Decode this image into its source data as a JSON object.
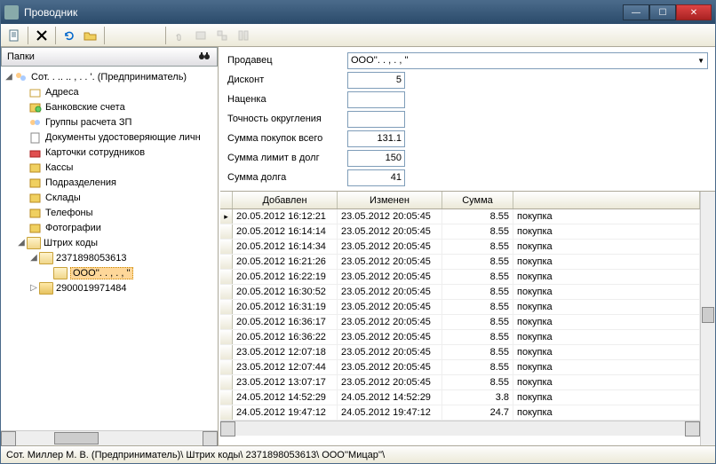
{
  "window": {
    "title": "Проводник"
  },
  "leftPanel": {
    "header": "Папки",
    "root": "Сот. .  .. .. ,  . .  '. (Предприниматель)",
    "items": [
      "Адреса",
      "Банковские счета",
      "Группы расчета ЗП",
      "Документы удостоверяющие личн",
      "Карточки сотрудников",
      "Кассы",
      "Подразделения",
      "Склады",
      "Телефоны",
      "Фотографии"
    ],
    "barcodeFolder": "Штрих коды",
    "barcode1": "2371898053613",
    "selected": "ООО''. .  , .  , ''",
    "barcode2": "2900019971484"
  },
  "form": {
    "labels": {
      "seller": "Продавец",
      "discount": "Дисконт",
      "markup": "Наценка",
      "rounding": "Точность округления",
      "totalBuys": "Сумма покупок всего",
      "creditLimit": "Сумма лимит в долг",
      "debt": "Сумма долга"
    },
    "values": {
      "seller": "ООО''. .  , .  , ''",
      "discount": "5",
      "markup": "",
      "rounding": "",
      "totalBuys": "131.1",
      "creditLimit": "150",
      "debt": "41"
    }
  },
  "grid": {
    "headers": {
      "added": "Добавлен",
      "changed": "Изменен",
      "sum": "Сумма"
    },
    "typeLabel": "покупка",
    "rows": [
      {
        "a": "20.05.2012 16:12:21",
        "c": "23.05.2012 20:05:45",
        "s": "8.55"
      },
      {
        "a": "20.05.2012 16:14:14",
        "c": "23.05.2012 20:05:45",
        "s": "8.55"
      },
      {
        "a": "20.05.2012 16:14:34",
        "c": "23.05.2012 20:05:45",
        "s": "8.55"
      },
      {
        "a": "20.05.2012 16:21:26",
        "c": "23.05.2012 20:05:45",
        "s": "8.55"
      },
      {
        "a": "20.05.2012 16:22:19",
        "c": "23.05.2012 20:05:45",
        "s": "8.55"
      },
      {
        "a": "20.05.2012 16:30:52",
        "c": "23.05.2012 20:05:45",
        "s": "8.55"
      },
      {
        "a": "20.05.2012 16:31:19",
        "c": "23.05.2012 20:05:45",
        "s": "8.55"
      },
      {
        "a": "20.05.2012 16:36:17",
        "c": "23.05.2012 20:05:45",
        "s": "8.55"
      },
      {
        "a": "20.05.2012 16:36:22",
        "c": "23.05.2012 20:05:45",
        "s": "8.55"
      },
      {
        "a": "23.05.2012 12:07:18",
        "c": "23.05.2012 20:05:45",
        "s": "8.55"
      },
      {
        "a": "23.05.2012 12:07:44",
        "c": "23.05.2012 20:05:45",
        "s": "8.55"
      },
      {
        "a": "23.05.2012 13:07:17",
        "c": "23.05.2012 20:05:45",
        "s": "8.55"
      },
      {
        "a": "24.05.2012 14:52:29",
        "c": "24.05.2012 14:52:29",
        "s": "3.8"
      },
      {
        "a": "24.05.2012 19:47:12",
        "c": "24.05.2012 19:47:12",
        "s": "24.7"
      }
    ]
  },
  "status": "Сот. Миллер М. В. (Предприниматель)\\ Штрих коды\\ 2371898053613\\ ООО''Мицар''\\"
}
